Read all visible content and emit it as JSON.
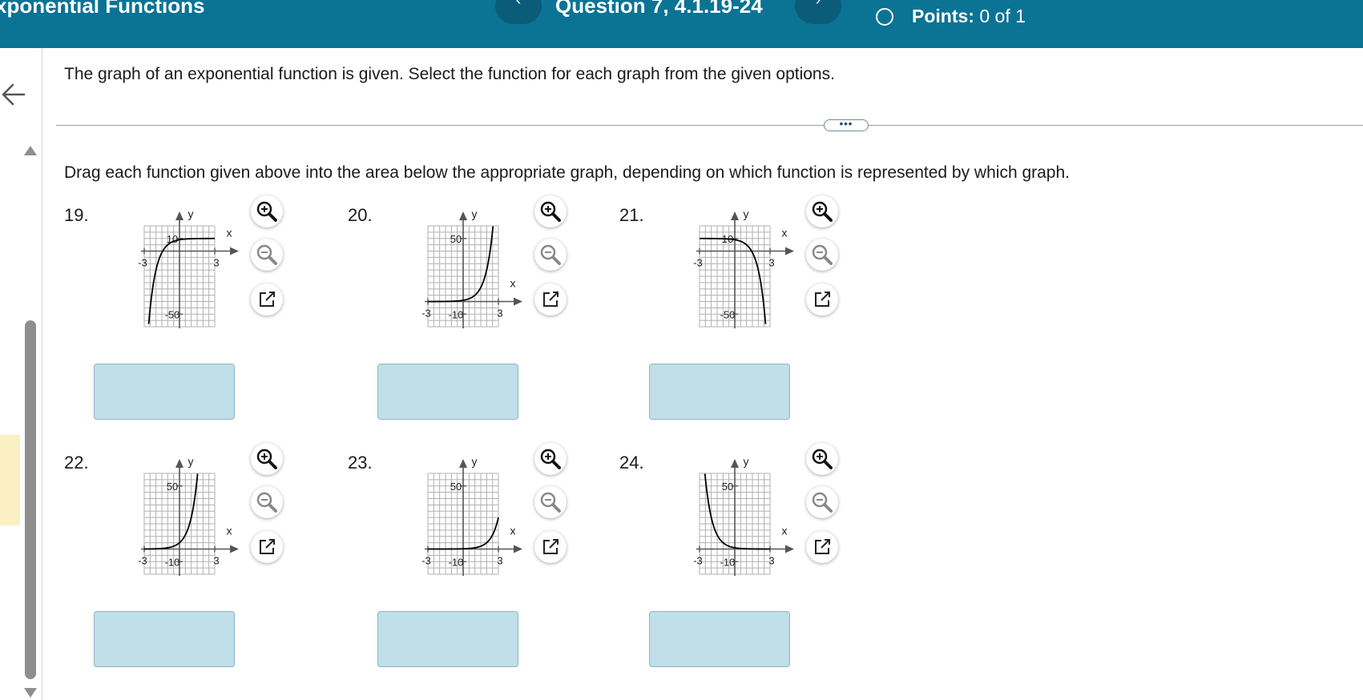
{
  "header": {
    "title": "xponential Functions",
    "prev_label": "‹",
    "next_label": "›",
    "question_label": "Question 7, 4.1.19-24",
    "points_label": "Points:",
    "points_value": "0 of 1"
  },
  "content": {
    "intro": "The graph of an exponential function is given. Select the function for each graph from the given options.",
    "more_label": "•••",
    "instructions": "Drag each function given above into the area below the appropriate graph, depending on which function is represented by which graph."
  },
  "graphs": [
    {
      "number": "19.",
      "x_min_label": "-3",
      "x_max_label": "3",
      "y_top_label": "10",
      "y_bottom_label": "-50",
      "x_axis_label": "x",
      "y_axis_label": "y",
      "x_range": [
        -3,
        3
      ],
      "y_range": [
        -60,
        20
      ],
      "curve": "-5^(-x)+10"
    },
    {
      "number": "20.",
      "x_min_label": "-3",
      "x_max_label": "3",
      "y_top_label": "50",
      "y_bottom_label": "-10",
      "x_axis_label": "x",
      "y_axis_label": "y",
      "x_range": [
        -3,
        3
      ],
      "y_range": [
        -20,
        60
      ],
      "curve": "5^x"
    },
    {
      "number": "21.",
      "x_min_label": "-3",
      "x_max_label": "3",
      "y_top_label": "10",
      "y_bottom_label": "-50",
      "x_axis_label": "x",
      "y_axis_label": "y",
      "x_range": [
        -3,
        3
      ],
      "y_range": [
        -60,
        20
      ],
      "curve": "-5^x+10"
    },
    {
      "number": "22.",
      "x_min_label": "-3",
      "x_max_label": "3",
      "y_top_label": "50",
      "y_bottom_label": "-10",
      "x_axis_label": "x",
      "y_axis_label": "y",
      "x_range": [
        -3,
        3
      ],
      "y_range": [
        -20,
        60
      ],
      "curve": "5^(x+1)"
    },
    {
      "number": "23.",
      "x_min_label": "-3",
      "x_max_label": "3",
      "y_top_label": "50",
      "y_bottom_label": "-10",
      "x_axis_label": "x",
      "y_axis_label": "y",
      "x_range": [
        -3,
        3
      ],
      "y_range": [
        -20,
        60
      ],
      "curve": "5^(x-1)"
    },
    {
      "number": "24.",
      "x_min_label": "-3",
      "x_max_label": "3",
      "y_top_label": "50",
      "y_bottom_label": "-10",
      "x_axis_label": "x",
      "y_axis_label": "y",
      "x_range": [
        -3,
        3
      ],
      "y_range": [
        -20,
        60
      ],
      "curve": "5^(-x)"
    }
  ],
  "icons": {
    "zoom_in": "zoom-in-icon",
    "zoom_out": "zoom-out-icon",
    "open_window": "open-new-window-icon",
    "back": "back-arrow-icon"
  },
  "colors": {
    "header_bg": "#0b7394",
    "drop_zone_bg": "#c0dfe8",
    "grid": "#b0b0b0",
    "axis": "#555555"
  }
}
